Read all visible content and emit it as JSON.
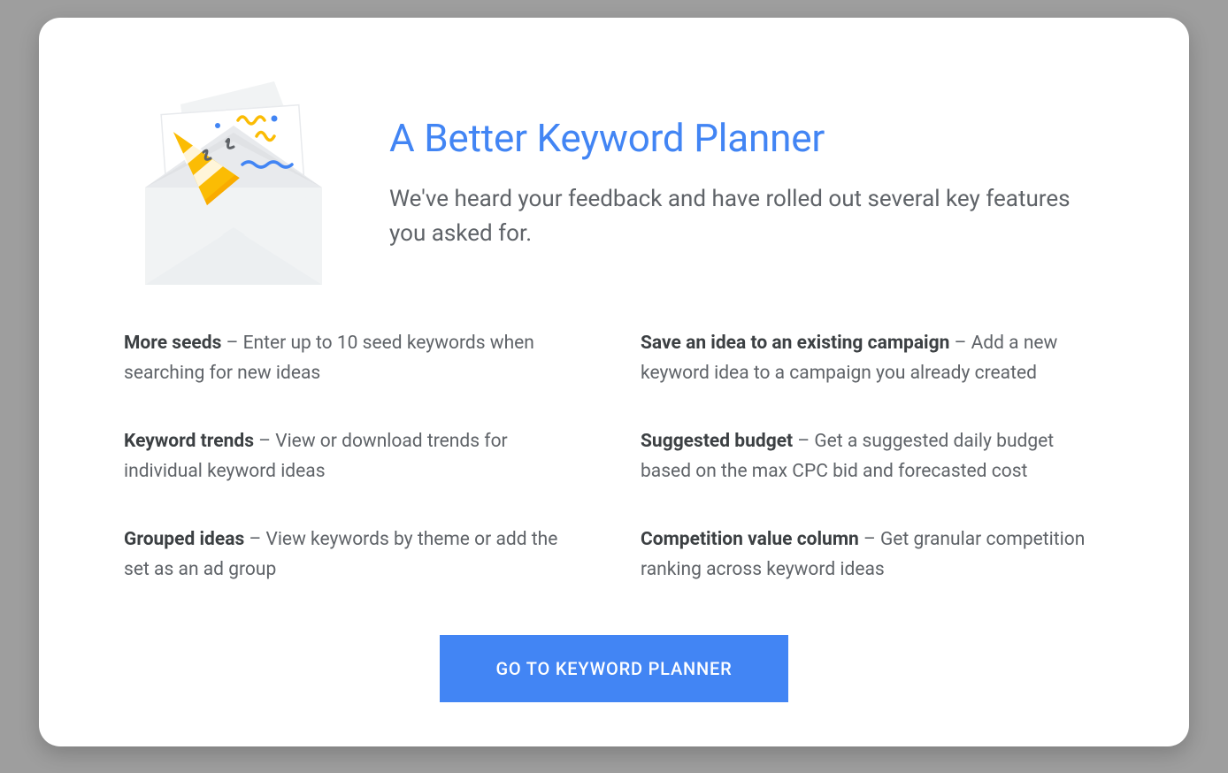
{
  "hero": {
    "title": "A Better Keyword Planner",
    "subtitle": "We've heard your feedback and have rolled out several key features you asked for."
  },
  "features": [
    {
      "title": "More seeds",
      "desc": " – Enter up to 10 seed keywords when searching for new ideas"
    },
    {
      "title": "Save an idea to an existing campaign",
      "desc": " – Add a new keyword idea to a campaign you already created"
    },
    {
      "title": "Keyword trends",
      "desc": " – View or download trends for individual keyword ideas"
    },
    {
      "title": "Suggested budget",
      "desc": " – Get a suggested daily budget based on the max CPC bid and forecasted cost"
    },
    {
      "title": "Grouped ideas",
      "desc": " – View keywords by theme or add the set as an ad group"
    },
    {
      "title": "Competition value column",
      "desc": " – Get granular competition ranking across keyword ideas"
    }
  ],
  "cta": {
    "label": "GO TO KEYWORD PLANNER"
  }
}
